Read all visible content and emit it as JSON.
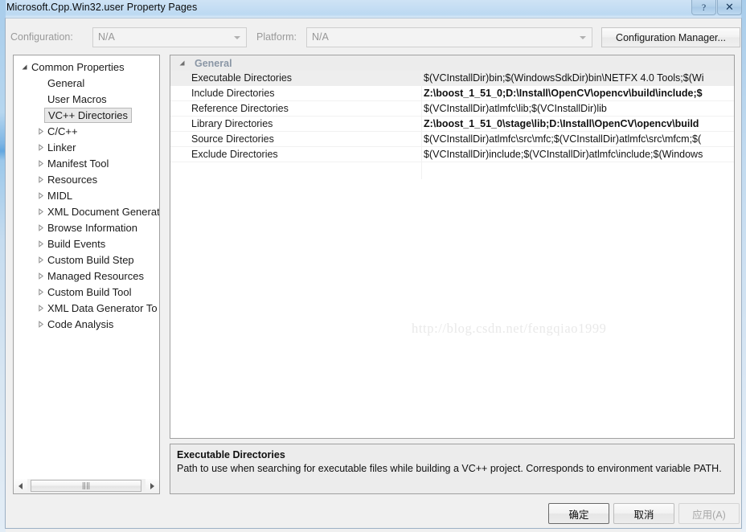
{
  "window": {
    "title": "Microsoft.Cpp.Win32.user Property Pages",
    "caption_buttons": [
      {
        "name": "help-button",
        "glyph": "?"
      },
      {
        "name": "close-button",
        "glyph": "✕"
      }
    ]
  },
  "config_bar": {
    "configuration_label": "Configuration:",
    "configuration_value": "N/A",
    "platform_label": "Platform:",
    "platform_value": "N/A",
    "configuration_manager_label": "Configuration Manager..."
  },
  "tree": {
    "items": [
      {
        "label": "Common Properties",
        "level": 0,
        "twisty": "expanded",
        "selected": false
      },
      {
        "label": "General",
        "level": 2,
        "twisty": "none",
        "selected": false
      },
      {
        "label": "User Macros",
        "level": 2,
        "twisty": "none",
        "selected": false
      },
      {
        "label": "VC++ Directories",
        "level": 2,
        "twisty": "none",
        "selected": true
      },
      {
        "label": "C/C++",
        "level": 1,
        "twisty": "collapsed",
        "selected": false
      },
      {
        "label": "Linker",
        "level": 1,
        "twisty": "collapsed",
        "selected": false
      },
      {
        "label": "Manifest Tool",
        "level": 1,
        "twisty": "collapsed",
        "selected": false
      },
      {
        "label": "Resources",
        "level": 1,
        "twisty": "collapsed",
        "selected": false
      },
      {
        "label": "MIDL",
        "level": 1,
        "twisty": "collapsed",
        "selected": false
      },
      {
        "label": "XML Document Generat",
        "level": 1,
        "twisty": "collapsed",
        "selected": false
      },
      {
        "label": "Browse Information",
        "level": 1,
        "twisty": "collapsed",
        "selected": false
      },
      {
        "label": "Build Events",
        "level": 1,
        "twisty": "collapsed",
        "selected": false
      },
      {
        "label": "Custom Build Step",
        "level": 1,
        "twisty": "collapsed",
        "selected": false
      },
      {
        "label": "Managed Resources",
        "level": 1,
        "twisty": "collapsed",
        "selected": false
      },
      {
        "label": "Custom Build Tool",
        "level": 1,
        "twisty": "collapsed",
        "selected": false
      },
      {
        "label": "XML Data Generator To",
        "level": 1,
        "twisty": "collapsed",
        "selected": false
      },
      {
        "label": "Code Analysis",
        "level": 1,
        "twisty": "collapsed",
        "selected": false
      }
    ],
    "scrollbar": {
      "grip": "‖‖"
    }
  },
  "grid": {
    "group_label": "General",
    "rows": [
      {
        "name": "Executable Directories",
        "value": "$(VCInstallDir)bin;$(WindowsSdkDir)bin\\NETFX 4.0 Tools;$(Wi",
        "bold": false,
        "selected": true
      },
      {
        "name": "Include Directories",
        "value": "Z:\\boost_1_51_0;D:\\Install\\OpenCV\\opencv\\build\\include;$",
        "bold": true,
        "selected": false
      },
      {
        "name": "Reference Directories",
        "value": "$(VCInstallDir)atlmfc\\lib;$(VCInstallDir)lib",
        "bold": false,
        "selected": false
      },
      {
        "name": "Library Directories",
        "value": "Z:\\boost_1_51_0\\stage\\lib;D:\\Install\\OpenCV\\opencv\\build",
        "bold": true,
        "selected": false
      },
      {
        "name": "Source Directories",
        "value": "$(VCInstallDir)atlmfc\\src\\mfc;$(VCInstallDir)atlmfc\\src\\mfcm;$(",
        "bold": false,
        "selected": false
      },
      {
        "name": "Exclude Directories",
        "value": "$(VCInstallDir)include;$(VCInstallDir)atlmfc\\include;$(Windows",
        "bold": false,
        "selected": false
      }
    ],
    "watermark": "http://blog.csdn.net/fengqiao1999"
  },
  "description": {
    "title": "Executable Directories",
    "body": "Path to use when searching for executable files while building a VC++ project.  Corresponds to environment variable PATH."
  },
  "footer": {
    "ok_label": "确定",
    "cancel_label": "取消",
    "apply_label": "应用(A)"
  }
}
